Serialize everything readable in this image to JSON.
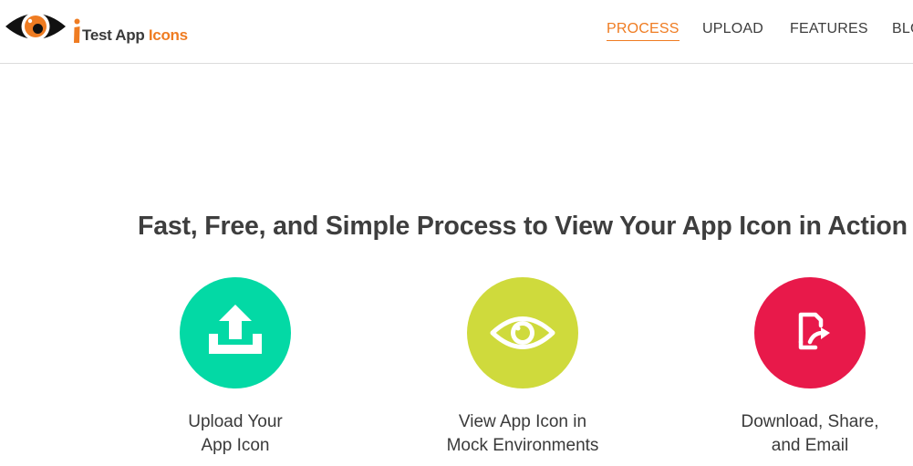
{
  "brand": {
    "name_dark": "Test App",
    "name_accent": "Icons",
    "logo_icon": "eye-icon",
    "accent_color": "#ef7c22"
  },
  "nav": {
    "items": [
      {
        "label": "PROCESS",
        "active": true
      },
      {
        "label": "UPLOAD",
        "active": false
      },
      {
        "label": "FEATURES",
        "active": false
      },
      {
        "label": "BLOG",
        "active": false
      }
    ]
  },
  "main": {
    "headline": "Fast, Free, and Simple Process to View Your App Icon in Action",
    "steps": [
      {
        "icon": "upload-icon",
        "color": "#03d9a5",
        "label_line1": "Upload Your",
        "label_line2": "App Icon"
      },
      {
        "icon": "eye-icon",
        "color": "#cfda3c",
        "label_line1": "View App Icon in",
        "label_line2": "Mock Environments"
      },
      {
        "icon": "share-icon",
        "color": "#e8194a",
        "label_line1": "Download, Share,",
        "label_line2": "and Email"
      }
    ]
  }
}
